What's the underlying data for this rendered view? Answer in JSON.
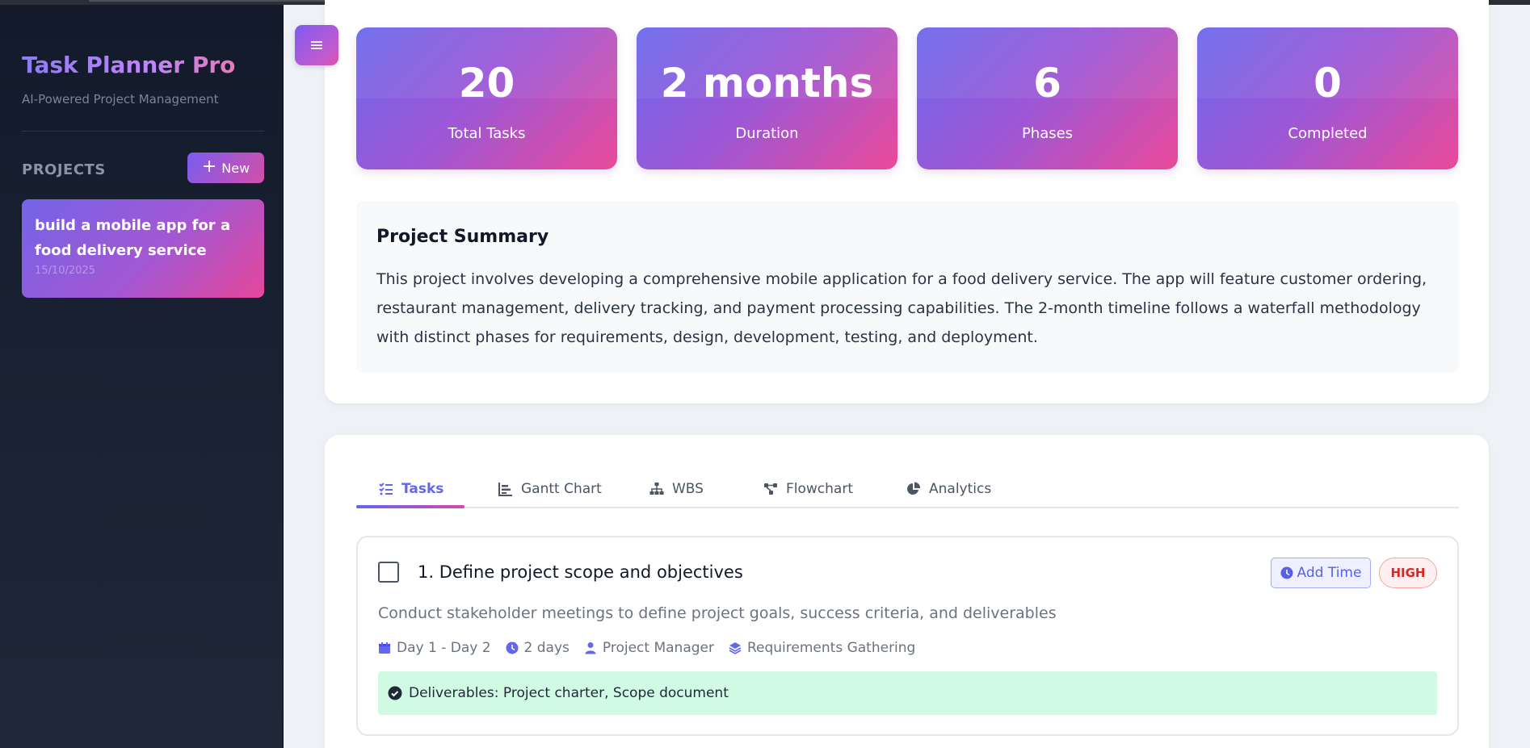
{
  "sidebar": {
    "app_title": "Task Planner Pro",
    "tagline": "AI-Powered Project Management",
    "projects_label": "PROJECTS",
    "new_button_label": "New",
    "projects": [
      {
        "title": "build a mobile app for a food delivery service",
        "date": "15/10/2025"
      }
    ]
  },
  "stats": [
    {
      "value": "20",
      "label": "Total Tasks"
    },
    {
      "value": "2 months",
      "label": "Duration"
    },
    {
      "value": "6",
      "label": "Phases"
    },
    {
      "value": "0",
      "label": "Completed"
    }
  ],
  "summary": {
    "title": "Project Summary",
    "text": "This project involves developing a comprehensive mobile application for a food delivery service. The app will feature customer ordering, restaurant management, delivery tracking, and payment processing capabilities. The 2-month timeline follows a waterfall methodology with distinct phases for requirements, design, development, testing, and deployment."
  },
  "tabs": [
    {
      "label": "Tasks",
      "icon": "list-check-icon",
      "active": true
    },
    {
      "label": "Gantt Chart",
      "icon": "bar-chart-icon",
      "active": false
    },
    {
      "label": "WBS",
      "icon": "sitemap-icon",
      "active": false
    },
    {
      "label": "Flowchart",
      "icon": "flow-icon",
      "active": false
    },
    {
      "label": "Analytics",
      "icon": "pie-chart-icon",
      "active": false
    }
  ],
  "tasks": [
    {
      "title": "1. Define project scope and objectives",
      "description": "Conduct stakeholder meetings to define project goals, success criteria, and deliverables",
      "add_time_label": "Add Time",
      "priority": "HIGH",
      "schedule": "Day 1 - Day 2",
      "duration": "2 days",
      "assignee": "Project Manager",
      "phase": "Requirements Gathering",
      "deliverables": "Deliverables: Project charter, Scope document"
    }
  ],
  "colors": {
    "accent": "#6366f1",
    "accent_pink": "#ec4899",
    "sidebar_bg": "#121a2b",
    "priority_high": "#dc2626",
    "deliverables_bg": "#d1fae5"
  }
}
